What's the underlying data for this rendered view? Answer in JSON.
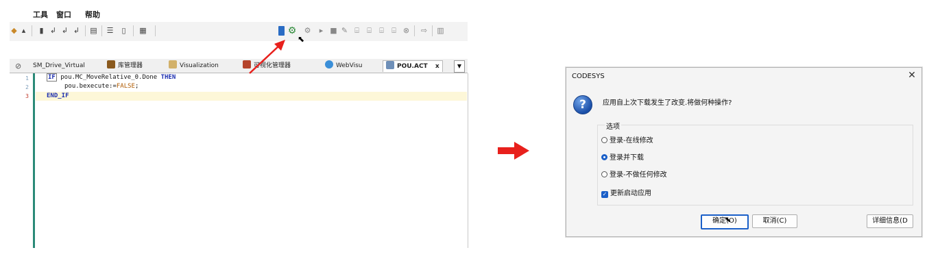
{
  "ide": {
    "menu": [
      "工具",
      "窗口",
      "帮助"
    ],
    "tabs": [
      {
        "label": "SM_Drive_Virtual",
        "icon": "link-icon"
      },
      {
        "label": "库管理器",
        "icon": "library-icon"
      },
      {
        "label": "Visualization",
        "icon": "visualization-icon"
      },
      {
        "label": "可视化管理器",
        "icon": "visu-manager-icon"
      },
      {
        "label": "WebVisu",
        "icon": "webvisu-icon"
      },
      {
        "label": "POU.ACT",
        "icon": "action-icon"
      }
    ],
    "tab_close": "x",
    "code": {
      "line_numbers": [
        "1",
        "2",
        "3"
      ],
      "l1_kw1": "IF",
      "l1_text": " pou.MC_MoveRelative_0.Done ",
      "l1_kw2": "THEN",
      "l2_text": "pou.bexecute:=",
      "l2_value": "FALSE",
      "l2_end": ";",
      "l3_kw": "END_IF"
    }
  },
  "dialog": {
    "title": "CODESYS",
    "close": "✕",
    "icon": "question-icon",
    "icon_glyph": "?",
    "message": "应用自上次下载发生了改变.将做何种操作?",
    "group_label": "选项",
    "options": [
      {
        "label": "登录-在线修改",
        "selected": false
      },
      {
        "label": "登录并下载",
        "selected": true
      },
      {
        "label": "登录-不做任何修改",
        "selected": false
      }
    ],
    "checkbox": {
      "label": "更新启动应用",
      "checked": true,
      "glyph": "✓"
    },
    "buttons": {
      "ok": "确定(O)",
      "cancel": "取消(C)",
      "details": "详细信息(D"
    }
  },
  "colors": {
    "accent": "#1a5fc8",
    "arrow": "#e8201c"
  }
}
